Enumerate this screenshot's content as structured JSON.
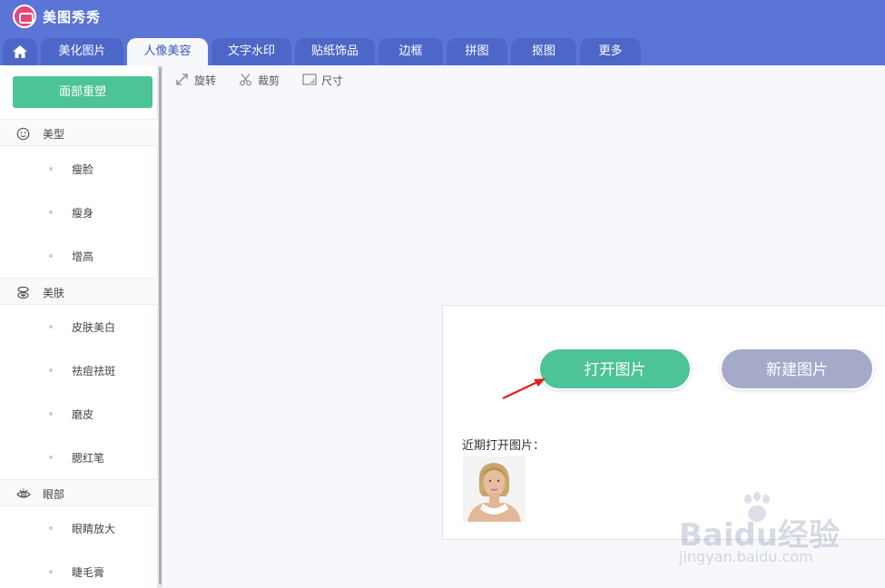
{
  "app": {
    "title": "美图秀秀",
    "accent": "#5b75d6",
    "tab_inactive": "#4d67c9",
    "green": "#4cc495",
    "grey_button": "#a4aac8"
  },
  "tabs": [
    {
      "label": "美化图片",
      "active": false
    },
    {
      "label": "人像美容",
      "active": true
    },
    {
      "label": "文字水印",
      "active": false
    },
    {
      "label": "贴纸饰品",
      "active": false
    },
    {
      "label": "边框",
      "active": false
    },
    {
      "label": "拼图",
      "active": false
    },
    {
      "label": "抠图",
      "active": false
    },
    {
      "label": "更多",
      "active": false
    }
  ],
  "sidebar": {
    "reshape_button": "面部重塑",
    "sections": [
      {
        "label": "美型",
        "icon": "face-icon",
        "items": [
          "瘦脸",
          "瘦身",
          "增高"
        ]
      },
      {
        "label": "美肤",
        "icon": "skin-icon",
        "items": [
          "皮肤美白",
          "祛痘祛斑",
          "磨皮",
          "腮红笔"
        ]
      },
      {
        "label": "眼部",
        "icon": "eye-icon",
        "items": [
          "眼睛放大",
          "睫毛膏"
        ]
      }
    ]
  },
  "toolbar": {
    "rotate": "旋转",
    "crop": "裁剪",
    "size": "尺寸"
  },
  "panel": {
    "open_button": "打开图片",
    "new_button": "新建图片",
    "recent_label": "近期打开图片："
  },
  "watermark": {
    "text": "Baidu经验",
    "sub": "jingyan.baidu.com"
  }
}
